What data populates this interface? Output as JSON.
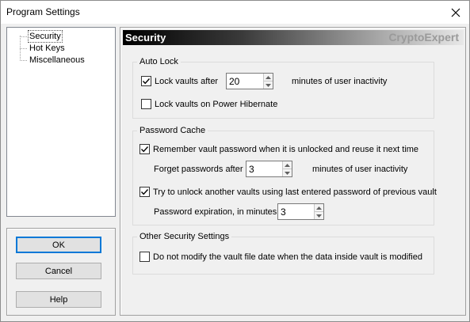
{
  "window": {
    "title": "Program Settings"
  },
  "tree": {
    "items": [
      {
        "label": "Security",
        "selected": true
      },
      {
        "label": "Hot Keys",
        "selected": false
      },
      {
        "label": "Miscellaneous",
        "selected": false
      }
    ]
  },
  "buttons": {
    "ok": "OK",
    "cancel": "Cancel",
    "help": "Help"
  },
  "header": {
    "title": "Security",
    "brand": "CryptoExpert"
  },
  "auto_lock": {
    "title": "Auto Lock",
    "lock_after_label": "Lock vaults after",
    "lock_after_checked": true,
    "lock_after_value": "20",
    "lock_after_suffix": "minutes of user inactivity",
    "hibernate_label": "Lock vaults on Power Hibernate",
    "hibernate_checked": false
  },
  "password_cache": {
    "title": "Password Cache",
    "remember_label": "Remember vault password when it is unlocked and reuse it next time",
    "remember_checked": true,
    "forget_label": "Forget passwords after",
    "forget_value": "3",
    "forget_suffix": "minutes of user inactivity",
    "try_unlock_label": "Try to unlock another vaults using last entered password of previous vault",
    "try_unlock_checked": true,
    "expiration_label": "Password expiration, in minutes:",
    "expiration_value": "3"
  },
  "other_security": {
    "title": "Other Security Settings",
    "no_modify_label": "Do not modify the vault file date when the data inside vault is modified",
    "no_modify_checked": false
  }
}
